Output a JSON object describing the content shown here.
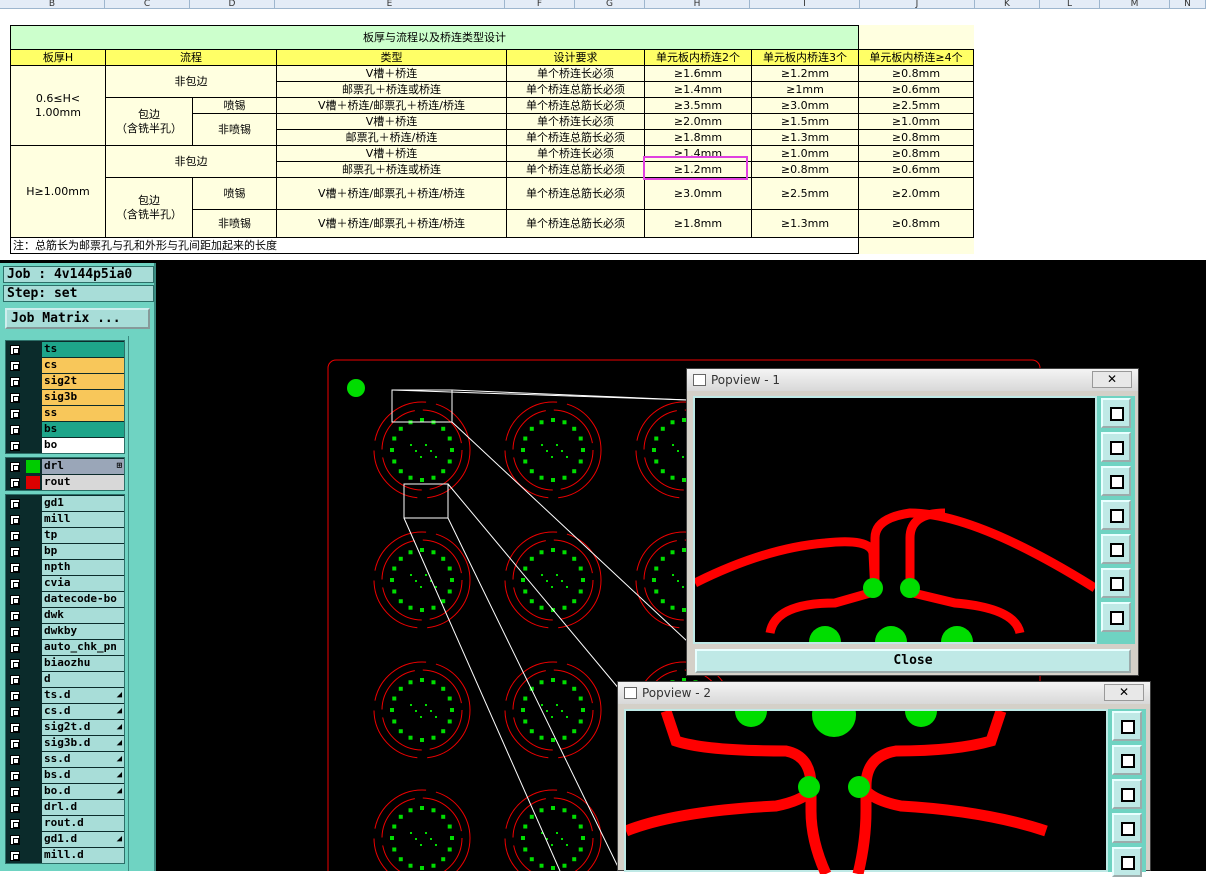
{
  "sheet": {
    "columns": [
      "B",
      "C",
      "D",
      "E",
      "F",
      "G",
      "H",
      "I",
      "J",
      "K",
      "L",
      "M",
      "N"
    ],
    "title": "板厚与流程以及桥连类型设计",
    "headers": [
      "板厚H",
      "流程",
      "类型",
      "设计要求",
      "单元板内桥连2个",
      "单元板内桥连3个",
      "单元板内桥连≥4个"
    ],
    "g1_thickness": "0.6≤H<\n1.00mm",
    "g2_thickness": "H≥1.00mm",
    "non_wrap": "非包边",
    "wrap": "包边\n（含铣半孔）",
    "tin": "喷锡",
    "no_tin": "非喷锡",
    "rows": [
      [
        "V槽＋桥连",
        "单个桥连长必须",
        "≥1.6mm",
        "≥1.2mm",
        "≥0.8mm"
      ],
      [
        "邮票孔＋桥连或桥连",
        "单个桥连总筋长必须",
        "≥1.4mm",
        "≥1mm",
        "≥0.6mm"
      ],
      [
        "V槽＋桥连/邮票孔＋桥连/桥连",
        "单个桥连总筋长必须",
        "≥3.5mm",
        "≥3.0mm",
        "≥2.5mm"
      ],
      [
        "V槽＋桥连",
        "单个桥连长必须",
        "≥2.0mm",
        "≥1.5mm",
        "≥1.0mm"
      ],
      [
        "邮票孔＋桥连/桥连",
        "单个桥连总筋长必须",
        "≥1.8mm",
        "≥1.3mm",
        "≥0.8mm"
      ],
      [
        "V槽＋桥连",
        "单个桥连长必须",
        "≥1.4mm",
        "≥1.0mm",
        "≥0.8mm"
      ],
      [
        "邮票孔＋桥连或桥连",
        "单个桥连总筋长必须",
        "≥1.2mm",
        "≥0.8mm",
        "≥0.6mm"
      ],
      [
        "V槽＋桥连/邮票孔＋桥连/桥连",
        "单个桥连总筋长必须",
        "≥3.0mm",
        "≥2.5mm",
        "≥2.0mm"
      ],
      [
        "V槽＋桥连/邮票孔＋桥连/桥连",
        "单个桥连总筋长必须",
        "≥1.8mm",
        "≥1.3mm",
        "≥0.8mm"
      ]
    ],
    "note": "注：总筋长为邮票孔与孔和外形与孔间距加起来的长度"
  },
  "job": {
    "job_label": "Job : 4v144p5ia0",
    "step_label": "Step: set",
    "matrix_button": "Job Matrix ..."
  },
  "layers_board": [
    {
      "name": "ts",
      "color": "#1ea58a"
    },
    {
      "name": "cs",
      "color": "#f8c75a"
    },
    {
      "name": "sig2t",
      "color": "#f8c75a"
    },
    {
      "name": "sig3b",
      "color": "#f8c75a"
    },
    {
      "name": "ss",
      "color": "#f8c75a"
    },
    {
      "name": "bs",
      "color": "#1ea58a"
    },
    {
      "name": "bo",
      "color": "#ffffff"
    }
  ],
  "layers_drill": [
    {
      "name": "drl",
      "color": "#9aa6b8",
      "swatch": "#00cc00",
      "mark": "⊞"
    },
    {
      "name": "rout",
      "color": "#d8d8d8",
      "swatch": "#dd0000",
      "mark": ""
    }
  ],
  "layers_misc": [
    {
      "name": "gd1",
      "mark": ""
    },
    {
      "name": "mill",
      "mark": ""
    },
    {
      "name": "tp",
      "mark": ""
    },
    {
      "name": "bp",
      "mark": ""
    },
    {
      "name": "npth",
      "mark": ""
    },
    {
      "name": "cvia",
      "mark": ""
    },
    {
      "name": "datecode-bo",
      "mark": ""
    },
    {
      "name": "dwk",
      "mark": ""
    },
    {
      "name": "dwkby",
      "mark": ""
    },
    {
      "name": "auto_chk_pn",
      "mark": ""
    },
    {
      "name": "biaozhu",
      "mark": ""
    },
    {
      "name": "d",
      "mark": ""
    },
    {
      "name": "ts.d",
      "mark": "◢"
    },
    {
      "name": "cs.d",
      "mark": "◢"
    },
    {
      "name": "sig2t.d",
      "mark": "◢"
    },
    {
      "name": "sig3b.d",
      "mark": "◢"
    },
    {
      "name": "ss.d",
      "mark": "◢"
    },
    {
      "name": "bs.d",
      "mark": "◢"
    },
    {
      "name": "bo.d",
      "mark": "◢"
    },
    {
      "name": "drl.d",
      "mark": ""
    },
    {
      "name": "rout.d",
      "mark": ""
    },
    {
      "name": "gd1.d",
      "mark": "◢"
    },
    {
      "name": "mill.d",
      "mark": ""
    }
  ],
  "popview1": {
    "title": "Popview - 1",
    "close_x": "✕",
    "close_button": "Close"
  },
  "popview2": {
    "title": "Popview - 2",
    "close_x": "✕"
  },
  "colors": {
    "teal": "#6fd3c2",
    "trace": "#ff0000",
    "pad": "#00dd00"
  }
}
